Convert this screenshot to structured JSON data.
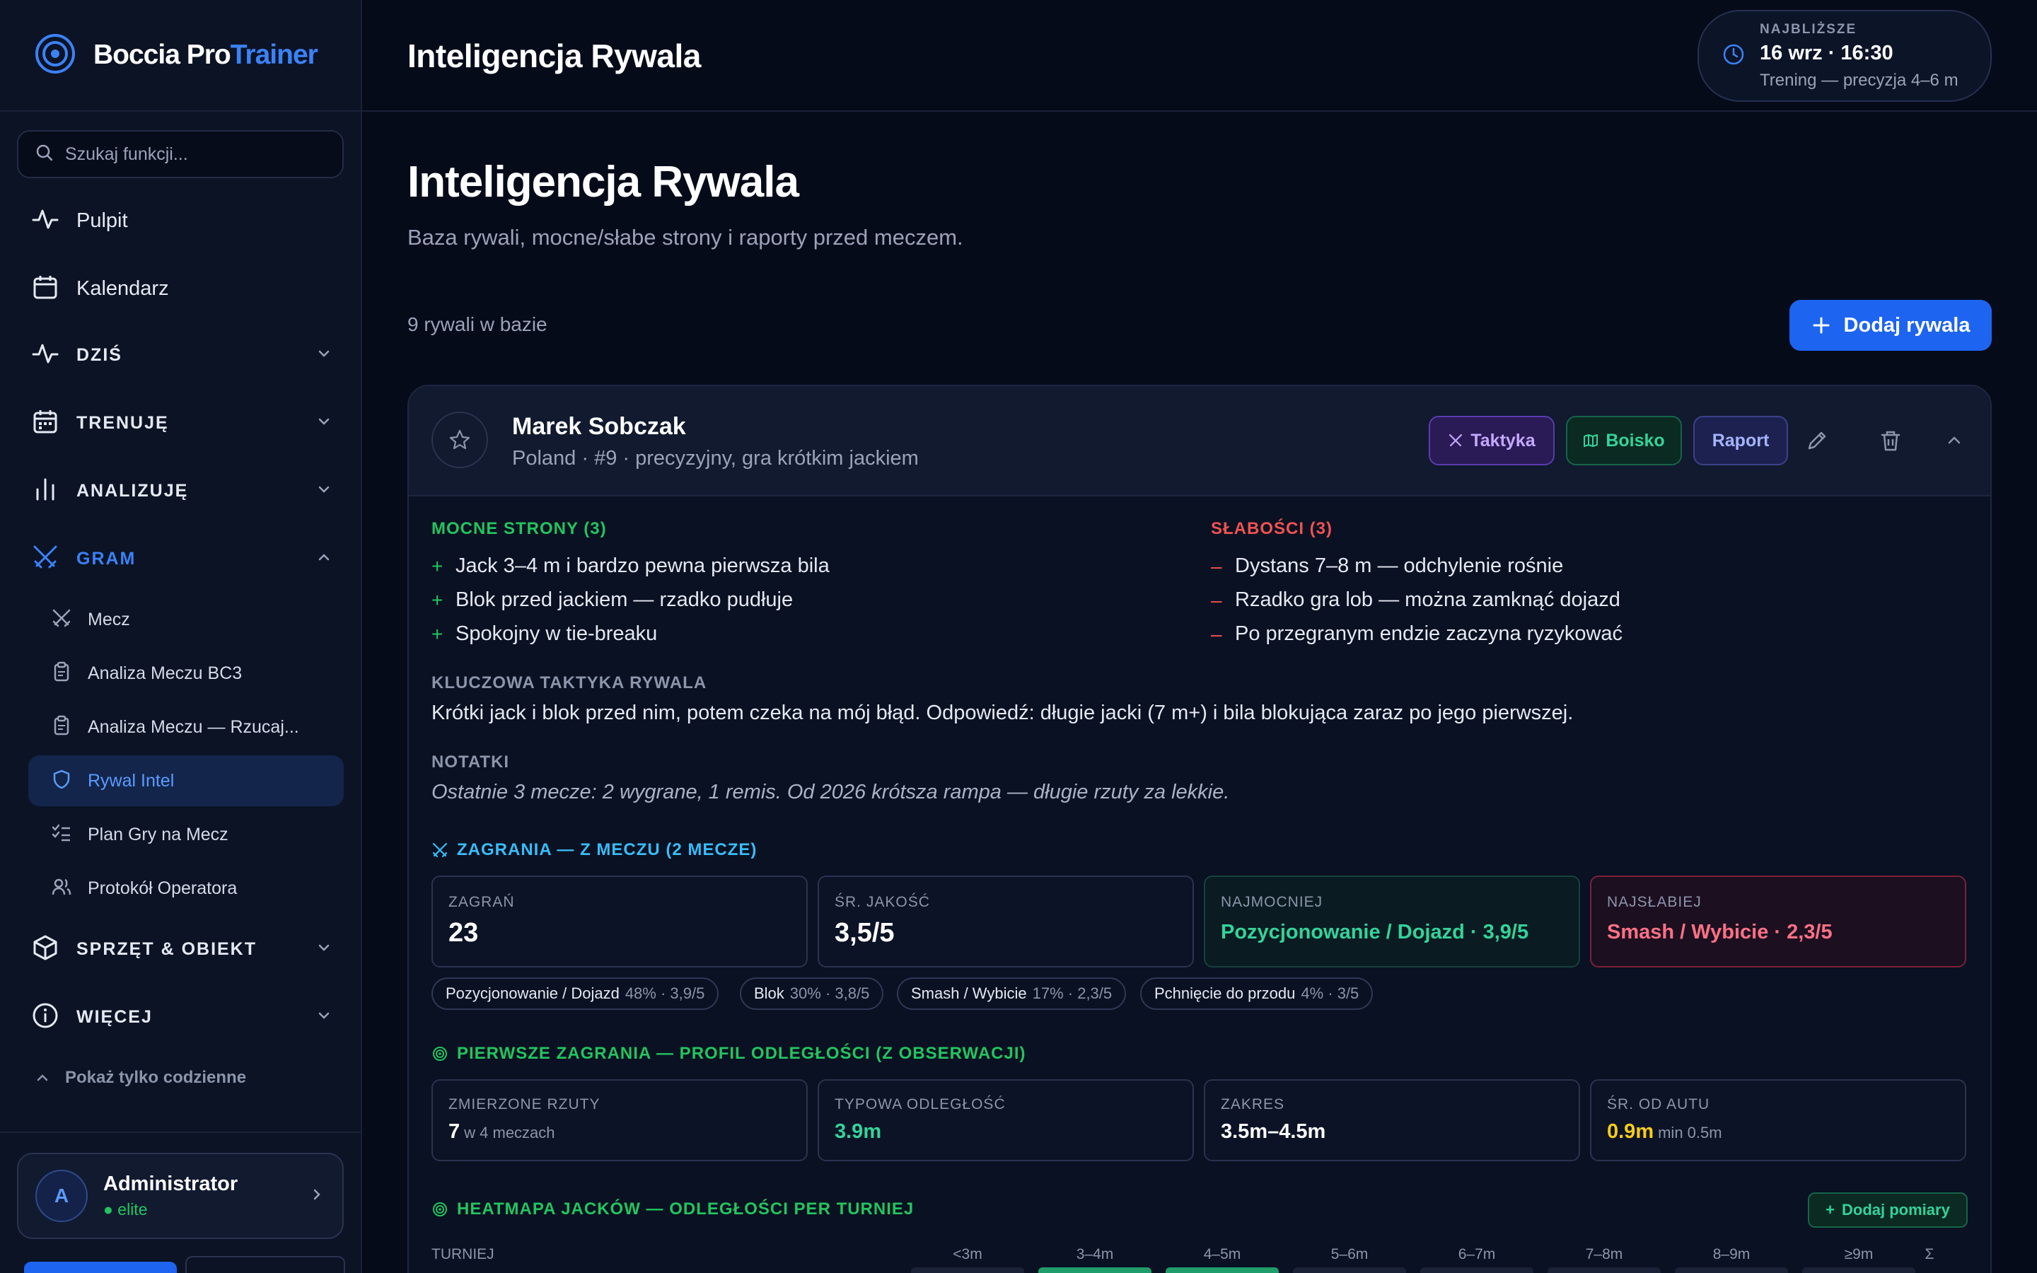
{
  "app": {
    "name_main": "Boccia Pro",
    "name_accent": "Trainer"
  },
  "sidebar": {
    "search_placeholder": "Szukaj funkcji...",
    "items": [
      {
        "label": "Pulpit",
        "icon": "activity-icon"
      },
      {
        "label": "Kalendarz",
        "icon": "calendar-icon"
      }
    ],
    "sections": [
      {
        "label": "DZIŚ",
        "icon": "activity-icon",
        "expanded": false
      },
      {
        "label": "TRENUJĘ",
        "icon": "calendar-check-icon",
        "expanded": false
      },
      {
        "label": "ANALIZUJĘ",
        "icon": "bar-chart-icon",
        "expanded": false
      },
      {
        "label": "GRAM",
        "icon": "swords-icon",
        "expanded": true
      },
      {
        "label": "SPRZĘT & OBIEKT",
        "icon": "box-icon",
        "expanded": false
      },
      {
        "label": "WIĘCEJ",
        "icon": "info-icon",
        "expanded": false
      }
    ],
    "gram_items": [
      {
        "label": "Mecz",
        "icon": "swords-icon"
      },
      {
        "label": "Analiza Meczu BC3",
        "icon": "clipboard-icon"
      },
      {
        "label": "Analiza Meczu — Rzucaj...",
        "icon": "clipboard-icon"
      },
      {
        "label": "Rywal Intel",
        "icon": "shield-icon",
        "active": true
      },
      {
        "label": "Plan Gry na Mecz",
        "icon": "list-check-icon"
      },
      {
        "label": "Protokół Operatora",
        "icon": "users-icon"
      }
    ],
    "show_daily": "Pokaż tylko codzienne",
    "user": {
      "initial": "A",
      "name": "Administrator",
      "role": "elite"
    }
  },
  "header": {
    "title": "Inteligencja Rywala",
    "next": {
      "kicker": "NAJBLIŻSZE",
      "time": "16 wrz · 16:30",
      "desc": "Trening — precyzja 4–6 m"
    }
  },
  "page": {
    "title": "Inteligencja Rywala",
    "subtitle": "Baza rywali, mocne/słabe strony i raporty przed meczem.",
    "count": "9 rywali w bazie",
    "add_button": "Dodaj rywala"
  },
  "rival": {
    "name": "Marek Sobczak",
    "meta": "Poland · #9 · precyzyjny, gra krótkim jackiem",
    "buttons": {
      "taktyka": "Taktyka",
      "boisko": "Boisko",
      "raport": "Raport"
    },
    "strengths_title": "MOCNE STRONY (3)",
    "strengths": [
      "Jack 3–4 m i bardzo pewna pierwsza bila",
      "Blok przed jackiem — rzadko pudłuje",
      "Spokojny w tie-breaku"
    ],
    "weaknesses_title": "SŁABOŚCI (3)",
    "weaknesses": [
      "Dystans 7–8 m — odchylenie rośnie",
      "Rzadko gra lob — można zamknąć dojazd",
      "Po przegranym endzie zaczyna ryzykować"
    ],
    "tactic_title": "KLUCZOWA TAKTYKA RYWALA",
    "tactic": "Krótki jack i blok przed nim, potem czeka na mój błąd. Odpowiedź: długie jacki (7 m+) i bila blokująca zaraz po jego pierwszej.",
    "notes_title": "NOTATKI",
    "notes": "Ostatnie 3 mecze: 2 wygrane, 1 remis. Od 2026 krótsza rampa — długie rzuty za lekkie.",
    "plays": {
      "title": "ZAGRANIA — Z MECZU (2 MECZE)",
      "stats": [
        {
          "label": "ZAGRAŃ",
          "value": "23"
        },
        {
          "label": "ŚR. JAKOŚĆ",
          "value": "3,5/5"
        },
        {
          "label": "NAJMOCNIEJ",
          "value": "Pozycjonowanie / Dojazd · 3,9/5"
        },
        {
          "label": "NAJSŁABIEJ",
          "value": "Smash / Wybicie · 2,3/5"
        }
      ],
      "pills": [
        {
          "name": "Pozycjonowanie / Dojazd",
          "detail": "48% · 3,9/5"
        },
        {
          "name": "Blok",
          "detail": "30% · 3,8/5"
        },
        {
          "name": "Smash / Wybicie",
          "detail": "17% · 2,3/5"
        },
        {
          "name": "Pchnięcie do przodu",
          "detail": "4% · 3/5"
        }
      ]
    },
    "first_plays": {
      "title": "PIERWSZE ZAGRANIA — PROFIL ODLEGŁOŚCI (Z OBSERWACJI)",
      "stats": [
        {
          "label": "ZMIERZONE RZUTY",
          "value": "7",
          "small": "w 4 meczach"
        },
        {
          "label": "TYPOWA ODLEGŁOŚĆ",
          "value": "3.9m",
          "small": ""
        },
        {
          "label": "ZAKRES",
          "value": "3.5m–4.5m",
          "small": ""
        },
        {
          "label": "ŚR. OD AUTU",
          "value": "0.9m",
          "small": "min 0.5m"
        }
      ]
    },
    "heatmap": {
      "title": "HEATMAPA JACKÓW — ODLEGŁOŚCI PER TURNIEJ",
      "add_button": "Dodaj pomiary",
      "row_header": "TURNIEJ",
      "columns": [
        "<3m",
        "3–4m",
        "4–5m",
        "5–6m",
        "6–7m",
        "7–8m",
        "8–9m",
        "≥9m",
        "Σ"
      ],
      "hot_columns": [
        1,
        2
      ]
    }
  },
  "colors": {
    "accent": "#1d64f0",
    "green": "#22c55e",
    "red": "#f05252",
    "yellow": "#facc15",
    "pink": "#fb7185"
  }
}
